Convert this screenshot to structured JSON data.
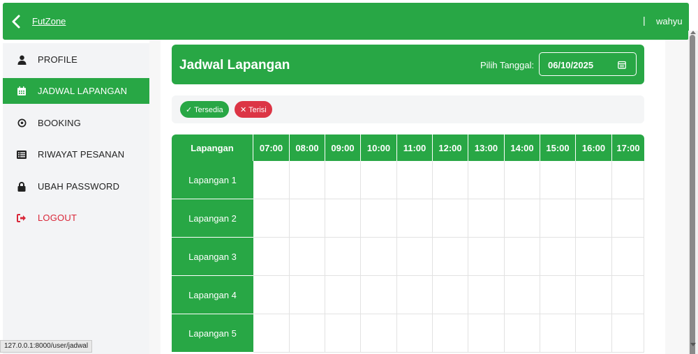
{
  "topbar": {
    "brand": "FutZone",
    "separator": "|",
    "username": "wahyu"
  },
  "sidebar": {
    "items": [
      {
        "label": "PROFILE",
        "icon": "user-icon"
      },
      {
        "label": "JADWAL LAPANGAN",
        "icon": "calendar-icon",
        "active": true
      },
      {
        "label": "BOOKING",
        "icon": "soccer-ball-icon"
      },
      {
        "label": "RIWAYAT PESANAN",
        "icon": "list-icon"
      },
      {
        "label": "UBAH PASSWORD",
        "icon": "lock-icon"
      },
      {
        "label": "LOGOUT",
        "icon": "logout-icon"
      }
    ]
  },
  "header": {
    "title": "Jadwal Lapangan",
    "date_label": "Pilih Tanggal:",
    "date_value": "06/10/2025"
  },
  "legend": {
    "available": "✓ Tersedia",
    "booked": "✕ Terisi"
  },
  "schedule": {
    "column_header": "Lapangan",
    "times": [
      "07:00",
      "08:00",
      "09:00",
      "10:00",
      "11:00",
      "12:00",
      "13:00",
      "14:00",
      "15:00",
      "16:00",
      "17:00"
    ],
    "fields": [
      "Lapangan 1",
      "Lapangan 2",
      "Lapangan 3",
      "Lapangan 4",
      "Lapangan 5"
    ]
  },
  "status_url": "127.0.0.1:8000/user/jadwal",
  "colors": {
    "primary": "#28a745",
    "danger": "#dc3545",
    "logout_text": "#d92638"
  }
}
